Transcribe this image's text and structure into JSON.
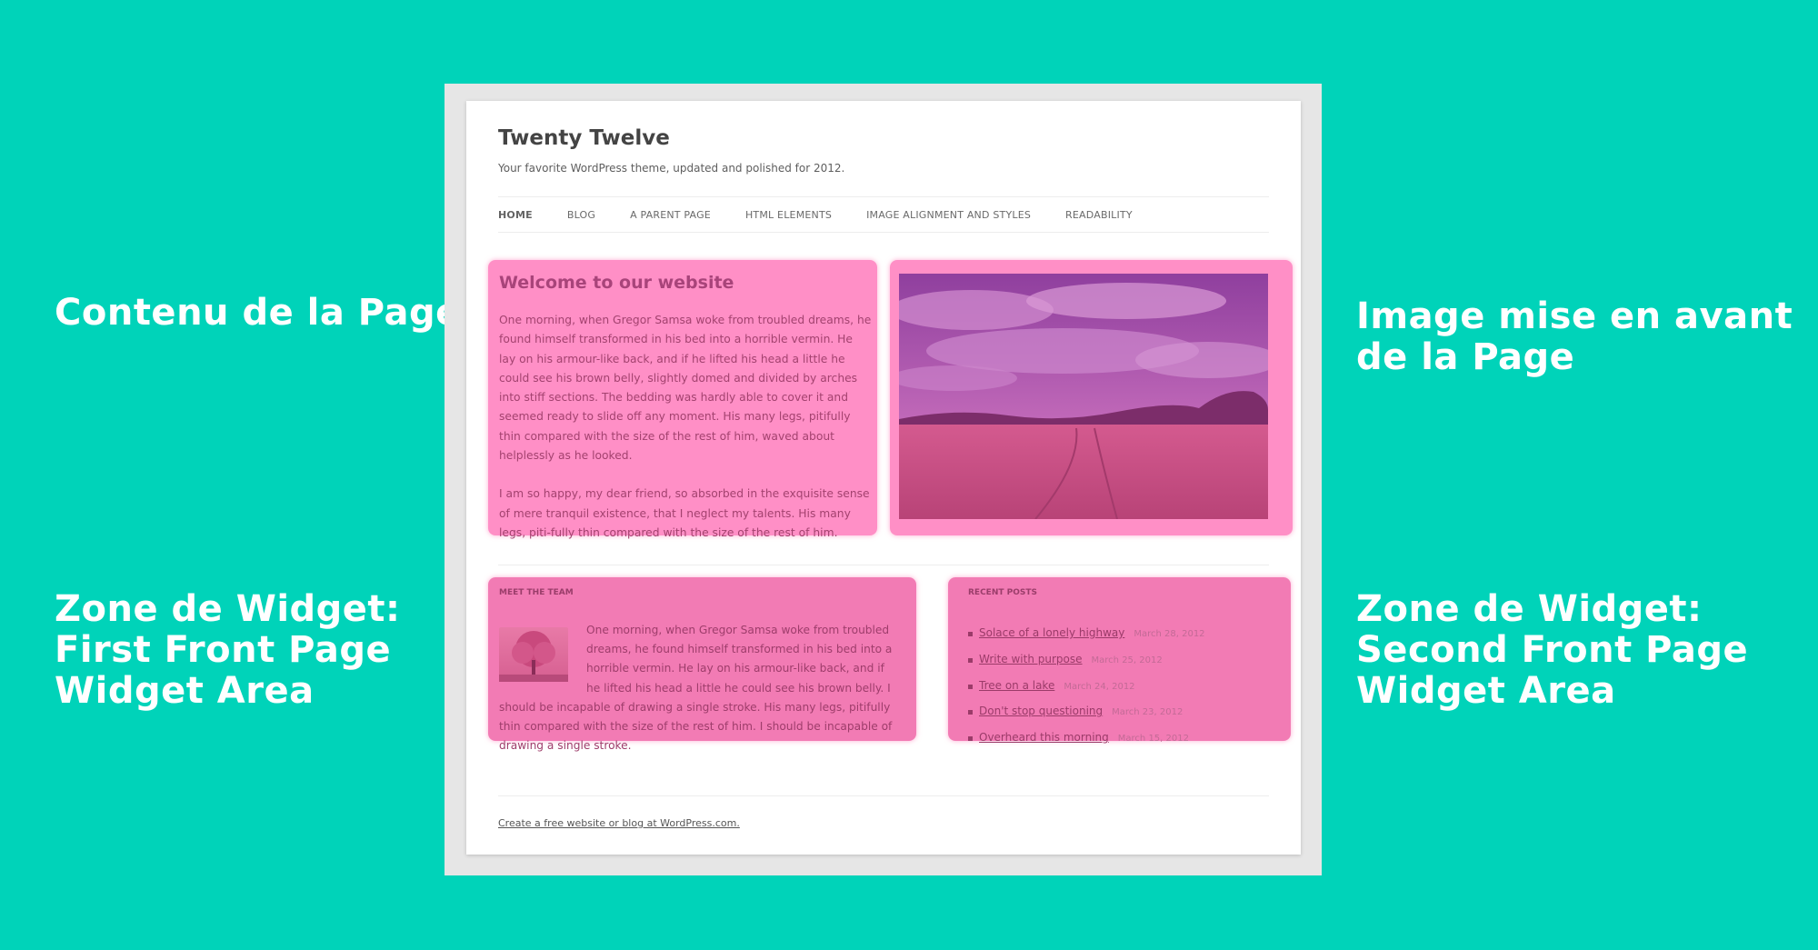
{
  "callouts": {
    "content": [
      "Contenu de la Page"
    ],
    "featured_image": [
      "Image mise en avant",
      "de la Page"
    ],
    "widget_first": [
      "Zone de Widget:",
      "First Front Page",
      "Widget Area"
    ],
    "widget_second": [
      "Zone de Widget:",
      "Second Front Page",
      "Widget Area"
    ]
  },
  "site": {
    "title": "Twenty Twelve",
    "description": "Your favorite WordPress theme, updated and polished for 2012."
  },
  "nav": {
    "items": [
      {
        "label": "HOME"
      },
      {
        "label": "BLOG"
      },
      {
        "label": "A PARENT PAGE"
      },
      {
        "label": "HTML ELEMENTS"
      },
      {
        "label": "IMAGE ALIGNMENT AND STYLES"
      },
      {
        "label": "READABILITY"
      }
    ]
  },
  "content": {
    "heading": "Welcome to our website",
    "paragraphs": [
      "One morning, when Gregor Samsa woke from troubled dreams, he found himself transformed in his bed into a horrible vermin. He lay on his armour-like back, and if he lifted his head a little he could see his brown belly, slightly domed and divided by arches into stiff sections. The bedding was hardly able to cover it and seemed ready to slide off any moment. His many legs, pitifully thin compared with the size of the rest of him, waved about helplessly as he looked.",
      "I am so happy, my dear friend, so absorbed in the exquisite sense of mere tranquil existence, that I neglect my talents. His many legs, piti-fully thin compared with the size of the rest of him."
    ]
  },
  "widget_team": {
    "title": "MEET THE TEAM",
    "text": "One morning, when Gregor Samsa woke from troubled dreams, he found himself transformed in his bed into a horrible vermin. He lay on his armour-like back, and if he lifted his head a little he could see his brown belly. I should be incapable of drawing a single stroke. His many legs, pitifully thin compared with the size of the rest of him. I should be incapable of drawing a single stroke."
  },
  "widget_posts": {
    "title": "RECENT POSTS",
    "posts": [
      {
        "title": "Solace of a lonely highway",
        "date": "March 28, 2012"
      },
      {
        "title": "Write with purpose",
        "date": "March 25, 2012"
      },
      {
        "title": "Tree on a lake",
        "date": "March 24, 2012"
      },
      {
        "title": "Don't stop questioning",
        "date": "March 23, 2012"
      },
      {
        "title": "Overheard this morning",
        "date": "March 15, 2012"
      }
    ]
  },
  "footer": {
    "link": "Create a free website or blog at WordPress.com."
  },
  "colors": {
    "background": "#00d3b9",
    "highlight": "#ff6fb6"
  }
}
